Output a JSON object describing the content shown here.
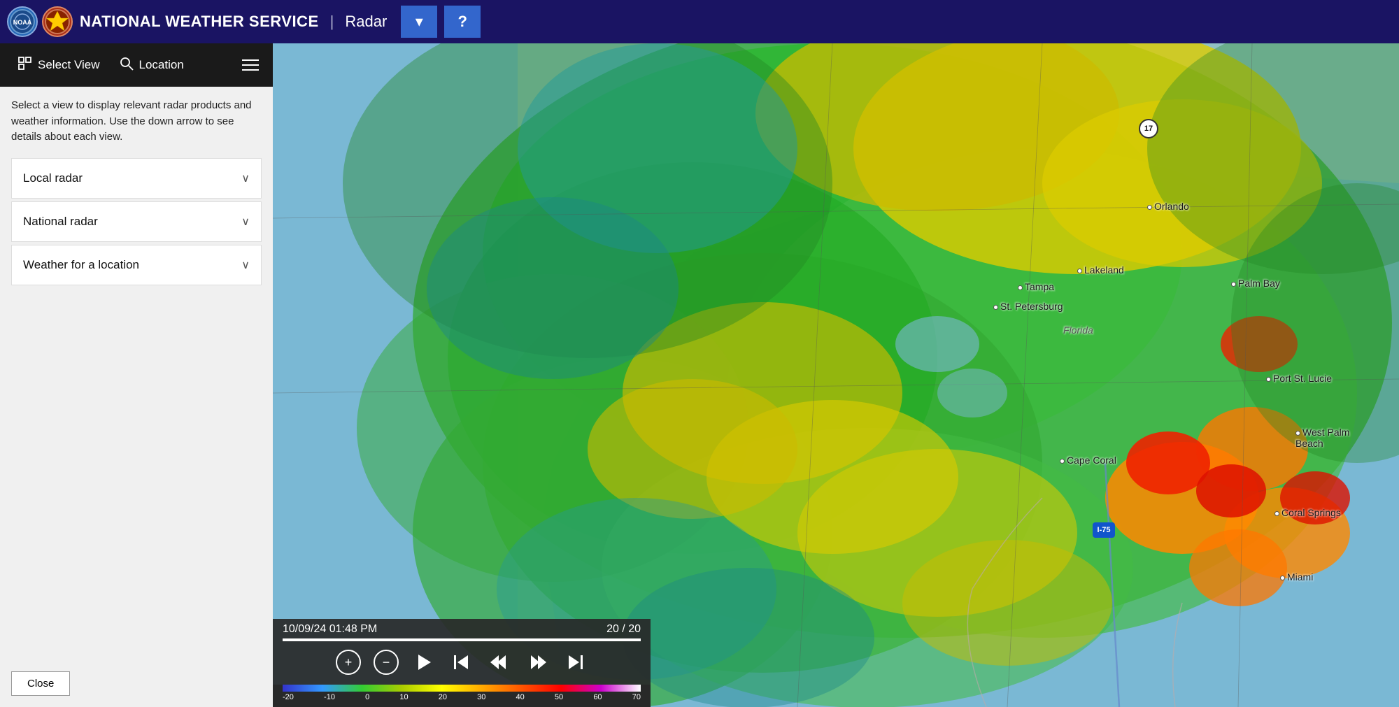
{
  "header": {
    "title": "NATIONAL WEATHER SERVICE",
    "divider": "|",
    "radar_label": "Radar",
    "dropdown_icon": "▾",
    "help_icon": "?",
    "logo_noaa_text": "NOAA",
    "logo_nws_text": "NWS"
  },
  "sidebar": {
    "tab_select_view": "Select View",
    "tab_location": "Location",
    "description": "Select a view to display relevant radar products and weather information. Use the down arrow to see details about each view.",
    "accordion_items": [
      {
        "label": "Local radar"
      },
      {
        "label": "National radar"
      },
      {
        "label": "Weather for a location"
      }
    ],
    "close_button": "Close"
  },
  "map": {
    "city_labels": [
      {
        "name": "Orlando",
        "top": "225",
        "left": "1260"
      },
      {
        "name": "Tampa",
        "top": "340",
        "left": "1075"
      },
      {
        "name": "Lakeland",
        "top": "318",
        "left": "1165"
      },
      {
        "name": "St. Petersburg",
        "top": "372",
        "left": "1055"
      },
      {
        "name": "Florida",
        "top": "405",
        "left": "1140"
      },
      {
        "name": "Palm Bay",
        "top": "338",
        "left": "1385"
      },
      {
        "name": "Port St. Lucie",
        "top": "475",
        "left": "1430"
      },
      {
        "name": "West Palm Beach",
        "top": "555",
        "left": "1470"
      },
      {
        "name": "Cape Coral",
        "top": "593",
        "left": "1140"
      },
      {
        "name": "Coral Springs",
        "top": "670",
        "left": "1445"
      },
      {
        "name": "Miami",
        "top": "760",
        "left": "1450"
      }
    ],
    "route_badge": {
      "top": "108",
      "left": "1238",
      "number": "17"
    },
    "interstate_badge": {
      "top": "688",
      "left": "1178",
      "number": "75"
    }
  },
  "player": {
    "datetime": "10/09/24 01:48 PM",
    "frame": "20 / 20",
    "scale_labels": [
      "-20",
      "-10",
      "0",
      "10",
      "20",
      "30",
      "40",
      "50",
      "60",
      "70"
    ]
  }
}
